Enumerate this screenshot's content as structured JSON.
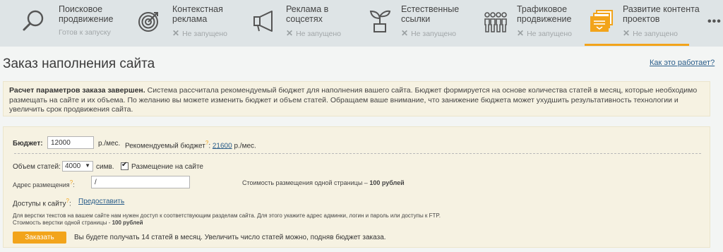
{
  "nav": {
    "items": [
      {
        "title": "Поисковое\nпродвижение",
        "status": "Готов к запуску",
        "has_x": false,
        "icon": "search-icon"
      },
      {
        "title": "Контекстная\nреклама",
        "status": "Не запущено",
        "has_x": true,
        "icon": "target-icon"
      },
      {
        "title": "Реклама в\nсоцсетях",
        "status": "Не запущено",
        "has_x": true,
        "icon": "megaphone-icon"
      },
      {
        "title": "Естественные\nссылки",
        "status": "Не запущено",
        "has_x": true,
        "icon": "sprout-icon"
      },
      {
        "title": "Трафиковое\nпродвижение",
        "status": "Не запущено",
        "has_x": true,
        "icon": "people-icon"
      },
      {
        "title": "Развитие контента\nпроектов",
        "status": "Не запущено",
        "has_x": true,
        "icon": "content-icon"
      }
    ],
    "more": "•••",
    "active_color": "#f2a41b"
  },
  "page": {
    "title": "Заказ наполнения сайта",
    "how_link": "Как это работает?"
  },
  "info": {
    "bold": "Расчет параметров заказа завершен.",
    "text": " Система рассчитала рекомендуемый бюджет для наполнения вашего сайта. Бюджет формируется на основе количества статей в месяц, которые необходимо размещать на сайте и их объема. По желанию вы можете изменить бюджет и объем статей. Обращаем ваше внимание, что занижение бюджета может ухудшить результативность технологии и увеличить срок продвижения сайта."
  },
  "form": {
    "budget_label": "Бюджет:",
    "budget_value": "12000",
    "budget_unit": "р./мес.",
    "recommended_label": "Рекомендуемый бюджет",
    "recommended_value": "21600",
    "recommended_unit": " р./мес.",
    "volume_label": "Объем статей:",
    "volume_value": "4000",
    "volume_unit": "симв.",
    "placement_label": "Размещение на сайте",
    "placement_checked": true,
    "address_label": "Адрес размещения",
    "address_value": "/",
    "page_cost_label": "Стоимость размещения одной страницы –",
    "page_cost_value": "100 рублей",
    "access_label": "Доступы к сайту",
    "access_link": "Предоставить",
    "access_note": "Для верстки текстов на вашем сайте нам нужен доступ к соответствующим разделам сайта. Для этого укажите адрес админки, логин и пароль или доступы к FTP.",
    "layout_cost_label": "Стоимость верстки одной страницы -",
    "layout_cost_value": "100 рублей",
    "order_button": "Заказать",
    "summary": "Вы будете получать 14 статей в месяц. Увеличить число статей можно, подняв бюджет заказа."
  }
}
